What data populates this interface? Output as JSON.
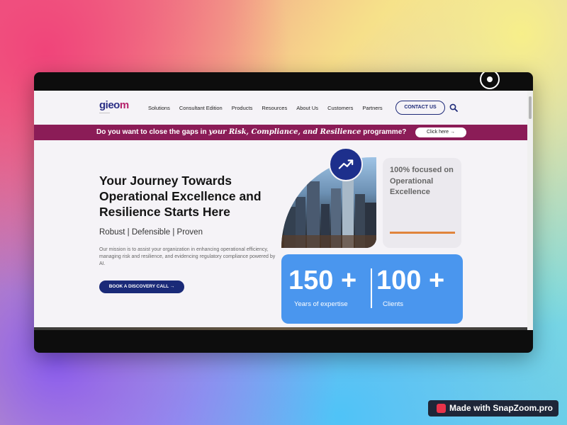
{
  "nav": {
    "logo": "gieom",
    "links": [
      "Solutions",
      "Consultant Edition",
      "Products",
      "Resources",
      "About Us",
      "Customers",
      "Partners"
    ],
    "contact_label": "CONTACT US",
    "search_icon": "search-icon"
  },
  "banner": {
    "prefix": "Do you want to close the gaps in ",
    "emphasis": "your Risk, Compliance, and Resilience",
    "suffix": " programme?",
    "button_label": "Click here"
  },
  "hero": {
    "title": "Your Journey Towards Operational Excellence and Resilience Starts Here",
    "subtitle": "Robust | Defensible | Proven",
    "description": "Our mission is to assist your organization in enhancing operational efficiency, managing risk and resilience, and evidencing regulatory compliance powered by AI.",
    "cta_label": "BOOK A DISCOVERY CALL"
  },
  "focus_card": {
    "text": "100% focused on Operational Excellence"
  },
  "stats": [
    {
      "number": "150 +",
      "label": "Years of expertise"
    },
    {
      "number": "100 +",
      "label": "Clients"
    }
  ],
  "watermark": {
    "text": "Made with SnapZoom.pro"
  },
  "colors": {
    "brand_navy": "#1d2f8c",
    "banner": "#8b1c57",
    "stats_blue": "#4a96ee",
    "accent_orange": "#e0843c"
  }
}
